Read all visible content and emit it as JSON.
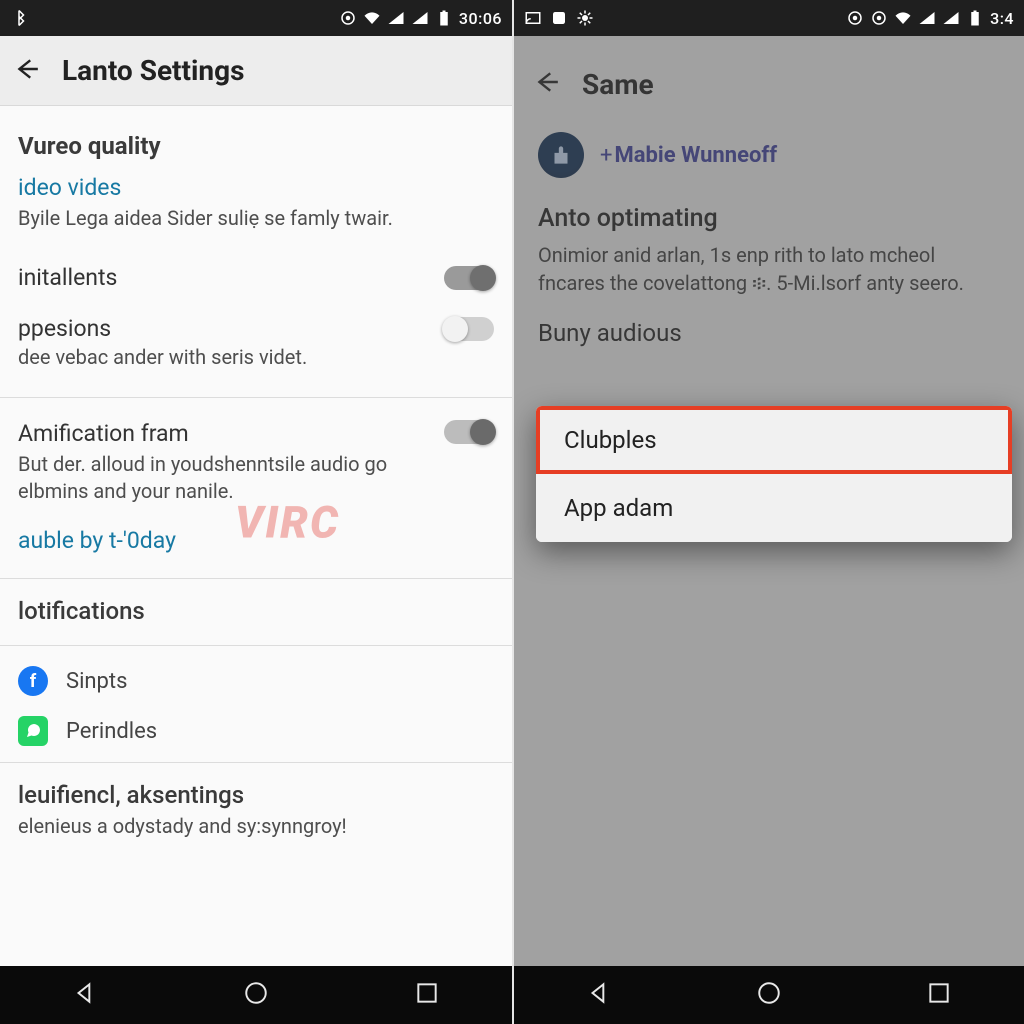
{
  "left": {
    "status": {
      "time": "30:06"
    },
    "appbar": {
      "title": "Lanto Settings"
    },
    "section1": "Vureo quality",
    "link1": "ideo vides",
    "sub1": "Byile Lega aidea Sider suliẹ se famly twair.",
    "toggle1": {
      "label": "initallents",
      "on": true
    },
    "toggle2": {
      "label": "ppesions",
      "sub": "dee vebac ander with seris videt.",
      "on": false
    },
    "toggle3": {
      "label": "Amification fram",
      "sub": "But der. alloud in youdshenntsile audio go elbmins and your nanile.",
      "on": false
    },
    "link2": "auble by t-'0day",
    "section2": "lotifications",
    "notif1": "Sinpts",
    "notif2": "Perindles",
    "section3": "leuifiencl, aksentings",
    "sub3": "elenieus a odystady and sy:synngroy!",
    "watermark": "VIRC"
  },
  "right": {
    "status": {
      "time": "3:4"
    },
    "appbar": {
      "title": "Same"
    },
    "profile": {
      "name": "Mabie Wunneoff"
    },
    "sec1": {
      "title": "Anto optimating",
      "body": "Onimior anid arlan, 1s enp rith to lato mcheol fncares the covelattong ፨. 5-Mi.lsorf anty seero."
    },
    "label2": "Buny audious",
    "popup": {
      "opt1": "Clubples",
      "opt2": "App adam"
    }
  }
}
